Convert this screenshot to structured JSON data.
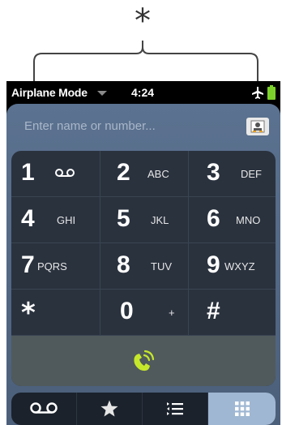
{
  "callout": {
    "symbol": "*"
  },
  "status": {
    "mode_label": "Airplane Mode",
    "time": "4:24",
    "icons": [
      "dropdown-caret-icon",
      "airplane-icon",
      "battery-icon"
    ]
  },
  "search": {
    "placeholder": "Enter name or number..."
  },
  "keypad": {
    "keys": [
      {
        "digit": "1",
        "letters": "",
        "icon": "voicemail-icon"
      },
      {
        "digit": "2",
        "letters": "ABC"
      },
      {
        "digit": "3",
        "letters": "DEF"
      },
      {
        "digit": "4",
        "letters": "GHI"
      },
      {
        "digit": "5",
        "letters": "JKL"
      },
      {
        "digit": "6",
        "letters": "MNO"
      },
      {
        "digit": "7",
        "letters": "PQRS"
      },
      {
        "digit": "8",
        "letters": "TUV"
      },
      {
        "digit": "9",
        "letters": "WXYZ"
      },
      {
        "digit": "*",
        "letters": ""
      },
      {
        "digit": "0",
        "letters": "+"
      },
      {
        "digit": "#",
        "letters": ""
      }
    ]
  },
  "toolbar": {
    "tabs": [
      "voicemail-icon",
      "favorites-star-icon",
      "call-log-icon",
      "dialpad-icon"
    ],
    "active_tab": "dialpad-icon"
  },
  "colors": {
    "call_accent": "#c6e82a",
    "screen_top": "#5b7290",
    "keypad_bg": "#2a323e",
    "active_tab": "#9fb7d2"
  }
}
